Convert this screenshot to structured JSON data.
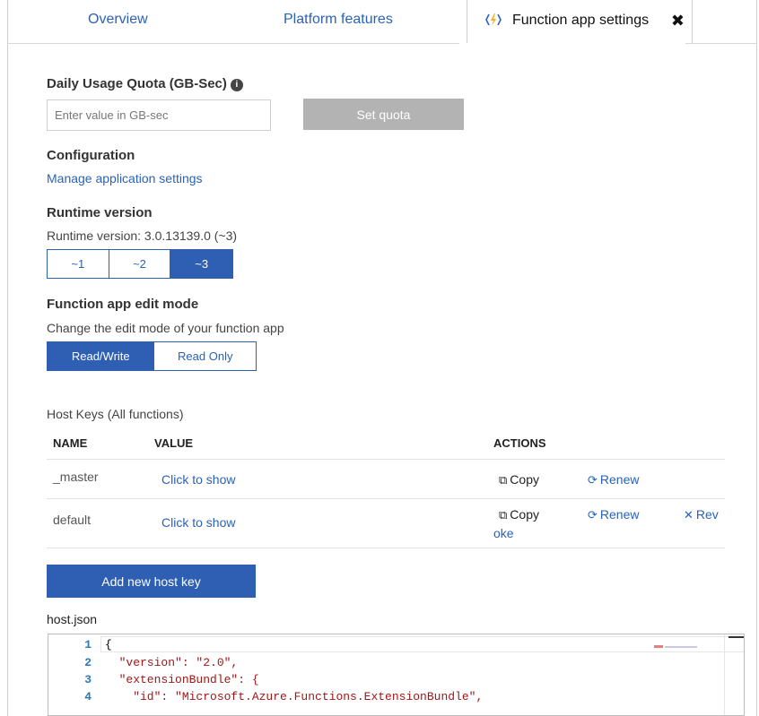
{
  "tabs": {
    "overview": "Overview",
    "platform": "Platform features",
    "active": "Function app settings"
  },
  "quota": {
    "title": "Daily Usage Quota (GB-Sec)",
    "placeholder": "Enter value in GB-sec",
    "button": "Set quota"
  },
  "configuration": {
    "title": "Configuration",
    "link": "Manage application settings"
  },
  "runtime": {
    "title": "Runtime version",
    "text": "Runtime version: 3.0.13139.0 (~3)",
    "options": [
      "~1",
      "~2",
      "~3"
    ],
    "selected": "~3"
  },
  "edit_mode": {
    "title": "Function app edit mode",
    "text": "Change the edit mode of your function app",
    "options": [
      "Read/Write",
      "Read Only"
    ],
    "selected": "Read/Write"
  },
  "host_keys": {
    "title": "Host Keys (All functions)",
    "columns": [
      "NAME",
      "VALUE",
      "ACTIONS"
    ],
    "rows": [
      {
        "name": "_master",
        "value": "Click to show",
        "copy": "Copy",
        "renew": "Renew"
      },
      {
        "name": "default",
        "value": "Click to show",
        "copy": "Copy",
        "renew": "Renew",
        "revoke_a": "Rev",
        "revoke_b": "oke"
      }
    ],
    "add_button": "Add new host key"
  },
  "host_json": {
    "label": "host.json",
    "line_numbers": [
      "1",
      "2",
      "3",
      "4"
    ],
    "lines": [
      "{",
      "  \"version\": \"2.0\",",
      "  \"extensionBundle\": {",
      "    \"id\": \"Microsoft.Azure.Functions.ExtensionBundle\","
    ]
  },
  "colors": {
    "accent": "#2f5fb3",
    "link": "#2a62b8",
    "disabled_button": "#b3b3b3"
  },
  "icons": [
    "function-bolt-icon",
    "close-icon",
    "info-icon",
    "copy-icon",
    "renew-icon",
    "revoke-icon"
  ]
}
